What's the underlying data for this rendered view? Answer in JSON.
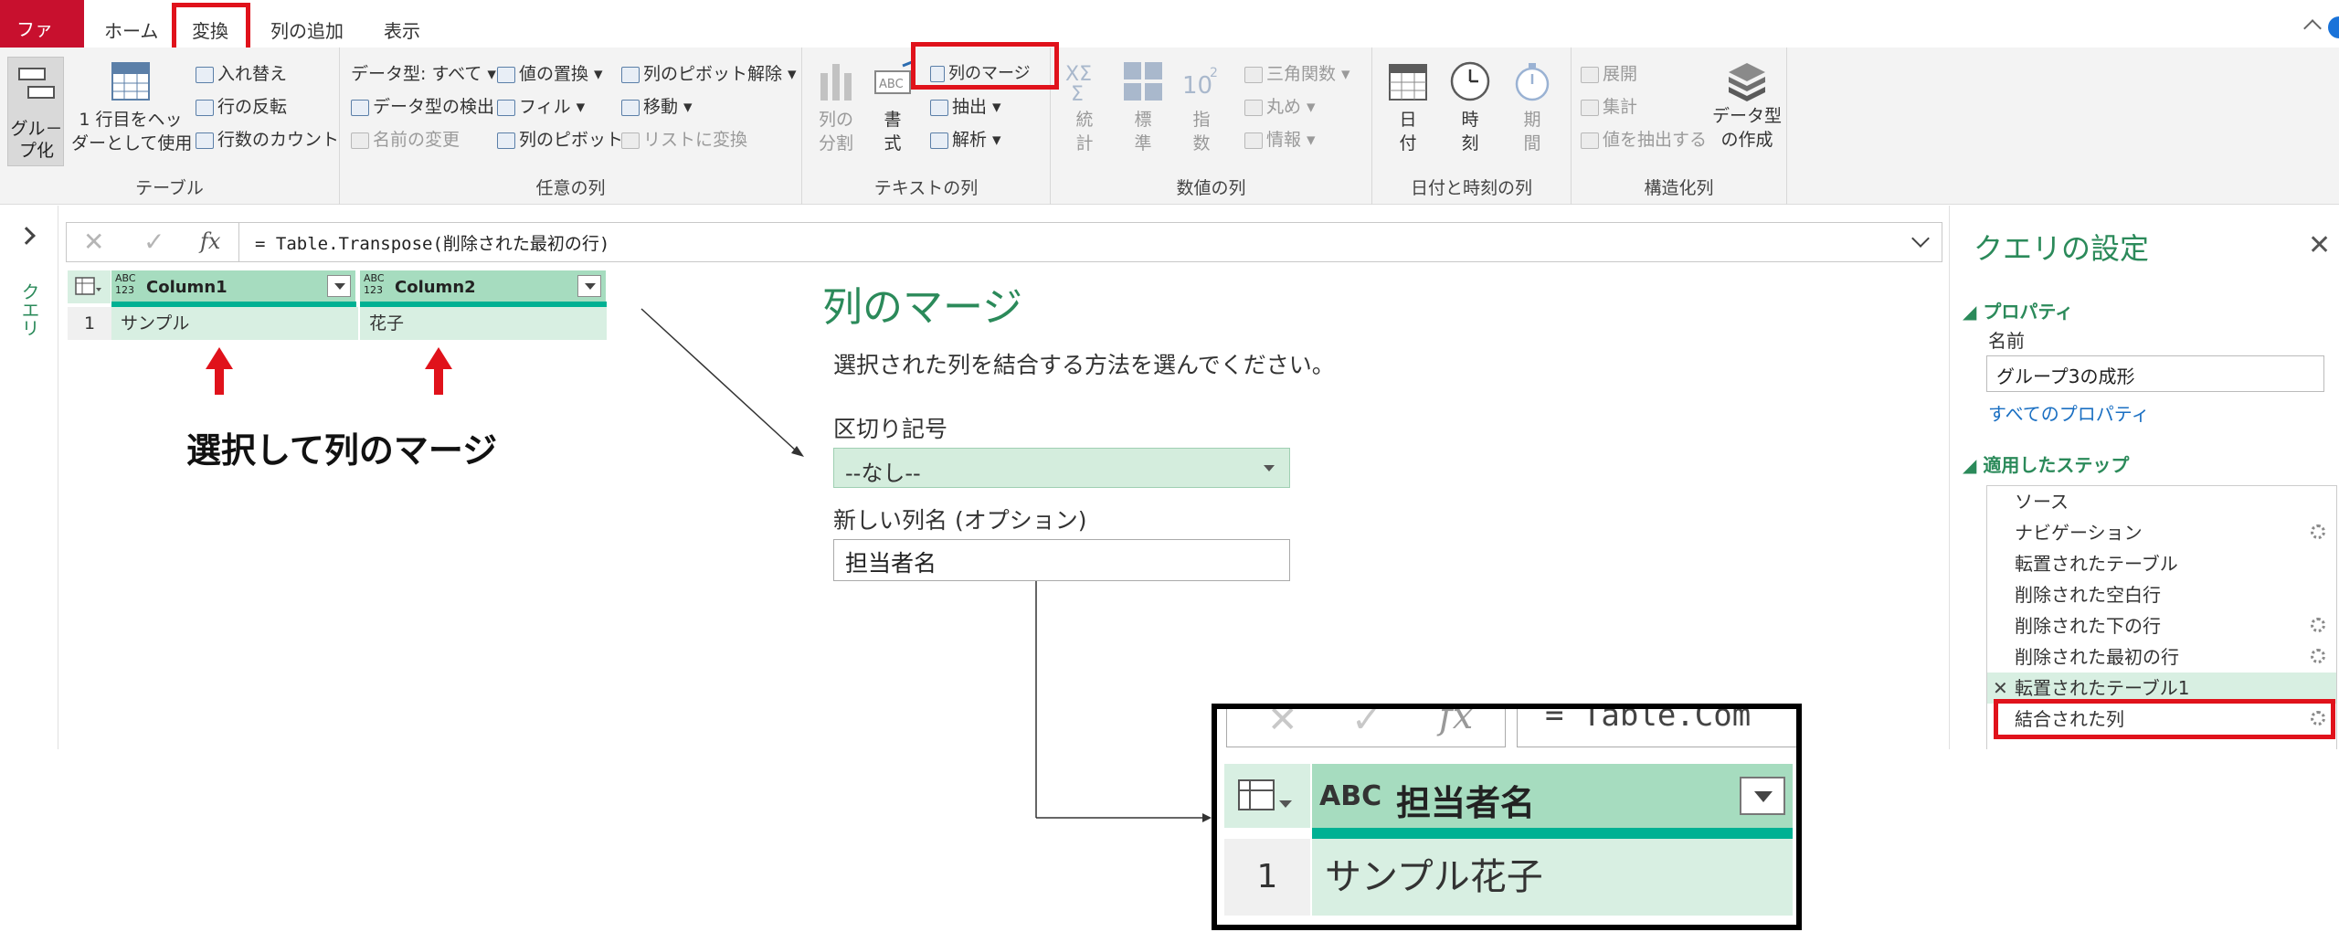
{
  "tabs": {
    "file": "ファイル",
    "home": "ホーム",
    "transform": "変換",
    "add_column": "列の追加",
    "view": "表示"
  },
  "ribbon": {
    "table_group": {
      "label": "テーブル",
      "group_by": "グル－\nプ化",
      "use_first_row": "1 行目をヘッ\nダーとして使用",
      "swap": "入れ替え",
      "reverse_rows": "行の反転",
      "count_rows": "行数のカウント"
    },
    "any_column_group": {
      "label": "任意の列",
      "data_type": "データ型: すべて",
      "detect_type": "データ型の検出",
      "rename": "名前の変更",
      "replace_values": "値の置換",
      "fill": "フィル",
      "pivot": "列のピボット",
      "unpivot": "列のピボット解除",
      "move": "移動",
      "to_list": "リストに変換"
    },
    "text_column_group": {
      "label": "テキストの列",
      "split": "列の\n分割",
      "format": "書\n式",
      "merge": "列のマージ",
      "extract": "抽出",
      "parse": "解析"
    },
    "number_column_group": {
      "label": "数値の列",
      "statistics": "統\n計",
      "standard": "標\n準",
      "scientific": "指\n数",
      "trig": "三角関数",
      "rounding": "丸め",
      "info": "情報"
    },
    "datetime_group": {
      "label": "日付と時刻の列",
      "date": "日\n付",
      "time": "時\n刻",
      "duration": "期\n間"
    },
    "structured_group": {
      "label": "構造化列",
      "expand": "展開",
      "aggregate": "集計",
      "extract_values": "値を抽出する",
      "create_data_type": "データ型\nの作成"
    }
  },
  "left_pane": {
    "label": "クエリ"
  },
  "formula_bar": {
    "text": "= Table.Transpose(削除された最初の行)"
  },
  "table": {
    "columns": [
      {
        "type": "ABC\n123",
        "name": "Column1"
      },
      {
        "type": "ABC\n123",
        "name": "Column2"
      }
    ],
    "rows": [
      {
        "num": "1",
        "cells": [
          "サンプル",
          "花子"
        ]
      }
    ]
  },
  "annotation": {
    "text": "選択して列のマージ"
  },
  "dialog": {
    "title": "列のマージ",
    "description": "選択された列を結合する方法を選んでください。",
    "separator_label": "区切り記号",
    "separator_value": "--なし--",
    "new_name_label": "新しい列名 (オプション)",
    "new_name_value": "担当者名"
  },
  "settings": {
    "title": "クエリの設定",
    "properties": "プロパティ",
    "name_label": "名前",
    "name_value": "グループ3の成形",
    "all_properties": "すべてのプロパティ",
    "applied_steps": "適用したステップ",
    "steps": [
      {
        "label": "ソース",
        "gear": false
      },
      {
        "label": "ナビゲーション",
        "gear": true
      },
      {
        "label": "転置されたテーブル",
        "gear": false
      },
      {
        "label": "削除された空白行",
        "gear": false
      },
      {
        "label": "削除された下の行",
        "gear": true
      },
      {
        "label": "削除された最初の行",
        "gear": true
      },
      {
        "label": "転置されたテーブル1",
        "gear": false
      },
      {
        "label": "結合された列",
        "gear": true
      }
    ]
  },
  "result": {
    "formula_fragment": "= Table.Com",
    "column_type": "ABC",
    "column_name": "担当者名",
    "row_num": "1",
    "row_value": "サンプル花子"
  },
  "colors": {
    "accent_red": "#e0121b",
    "header_green": "#a6dcbf",
    "cell_green": "#d8efe2",
    "teal": "#00b193",
    "title_green": "#2b8a5a"
  }
}
